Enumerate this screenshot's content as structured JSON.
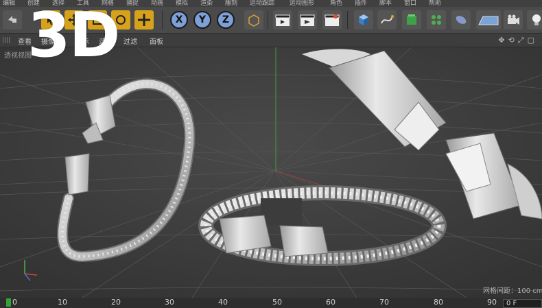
{
  "menu": [
    "编辑",
    "创建",
    "选择",
    "工具",
    "网格",
    "捕捉",
    "动画",
    "模拟",
    "渲染",
    "雕刻",
    "运动跟踪",
    "运动图形",
    "角色",
    "插件",
    "脚本",
    "窗口",
    "帮助"
  ],
  "toolbar": {
    "axis_x": "X",
    "axis_y": "Y",
    "axis_z": "Z"
  },
  "viewbar": {
    "items": [
      "查看",
      "摄像机",
      "显示",
      "选项",
      "过滤",
      "面板"
    ]
  },
  "viewport": {
    "label": "透视视图",
    "grid_distance": "网格间距：100 cm"
  },
  "overlay": {
    "title": "3D"
  },
  "timeline": {
    "ticks": [
      "0",
      "10",
      "20",
      "30",
      "40",
      "50",
      "60",
      "70",
      "80",
      "90"
    ],
    "frame": "0 F"
  },
  "colors": {
    "accent_yellow": "#d6a21a",
    "viewport_bg": "#3c3c3c",
    "overlay_text": "#ffffff"
  }
}
